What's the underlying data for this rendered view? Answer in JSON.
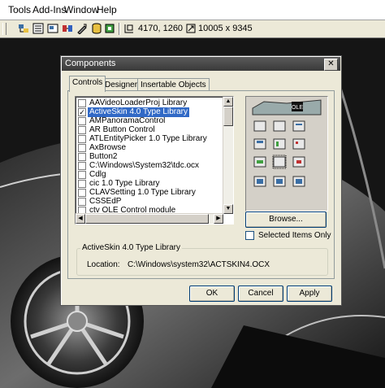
{
  "menu": {
    "tools": "Tools",
    "addins": "Add-Ins",
    "window": "Window",
    "help": "Help"
  },
  "toolbar": {
    "position_readout": "4170, 1260",
    "size_readout": "10005 x 9345"
  },
  "dialog": {
    "title": "Components",
    "close_glyph": "✕",
    "tabs": [
      {
        "label": "Controls",
        "active": true
      },
      {
        "label": "Designers",
        "active": false
      },
      {
        "label": "Insertable Objects",
        "active": false
      }
    ],
    "list_items": [
      {
        "label": "AAVideoLoaderProj Library",
        "checked": false,
        "selected": false
      },
      {
        "label": "ActiveSkin 4.0 Type Library",
        "checked": true,
        "selected": true
      },
      {
        "label": "AMPanoramaControl",
        "checked": false,
        "selected": false
      },
      {
        "label": "AR Button Control",
        "checked": false,
        "selected": false
      },
      {
        "label": "ATLEntityPicker 1.0 Type Library",
        "checked": false,
        "selected": false
      },
      {
        "label": "AxBrowse",
        "checked": false,
        "selected": false
      },
      {
        "label": "Button2",
        "checked": false,
        "selected": false
      },
      {
        "label": "C:\\Windows\\System32\\tdc.ocx",
        "checked": false,
        "selected": false
      },
      {
        "label": "Cdlg",
        "checked": false,
        "selected": false
      },
      {
        "label": "cic 1.0 Type Library",
        "checked": false,
        "selected": false
      },
      {
        "label": "CLAVSetting 1.0 Type Library",
        "checked": false,
        "selected": false
      },
      {
        "label": "CSSEdP",
        "checked": false,
        "selected": false
      },
      {
        "label": "ctv OLE Control module",
        "checked": false,
        "selected": false
      }
    ],
    "check_glyph": "✓",
    "browse_button": "Browse...",
    "selected_items_only": "Selected Items Only",
    "info_group_title": "ActiveSkin 4.0 Type Library",
    "location_label": "Location:",
    "location_value": "C:\\Windows\\system32\\ACTSKIN4.OCX",
    "ok_button": "OK",
    "cancel_button": "Cancel",
    "apply_button": "Apply",
    "preview_ole_label": "OLE"
  }
}
